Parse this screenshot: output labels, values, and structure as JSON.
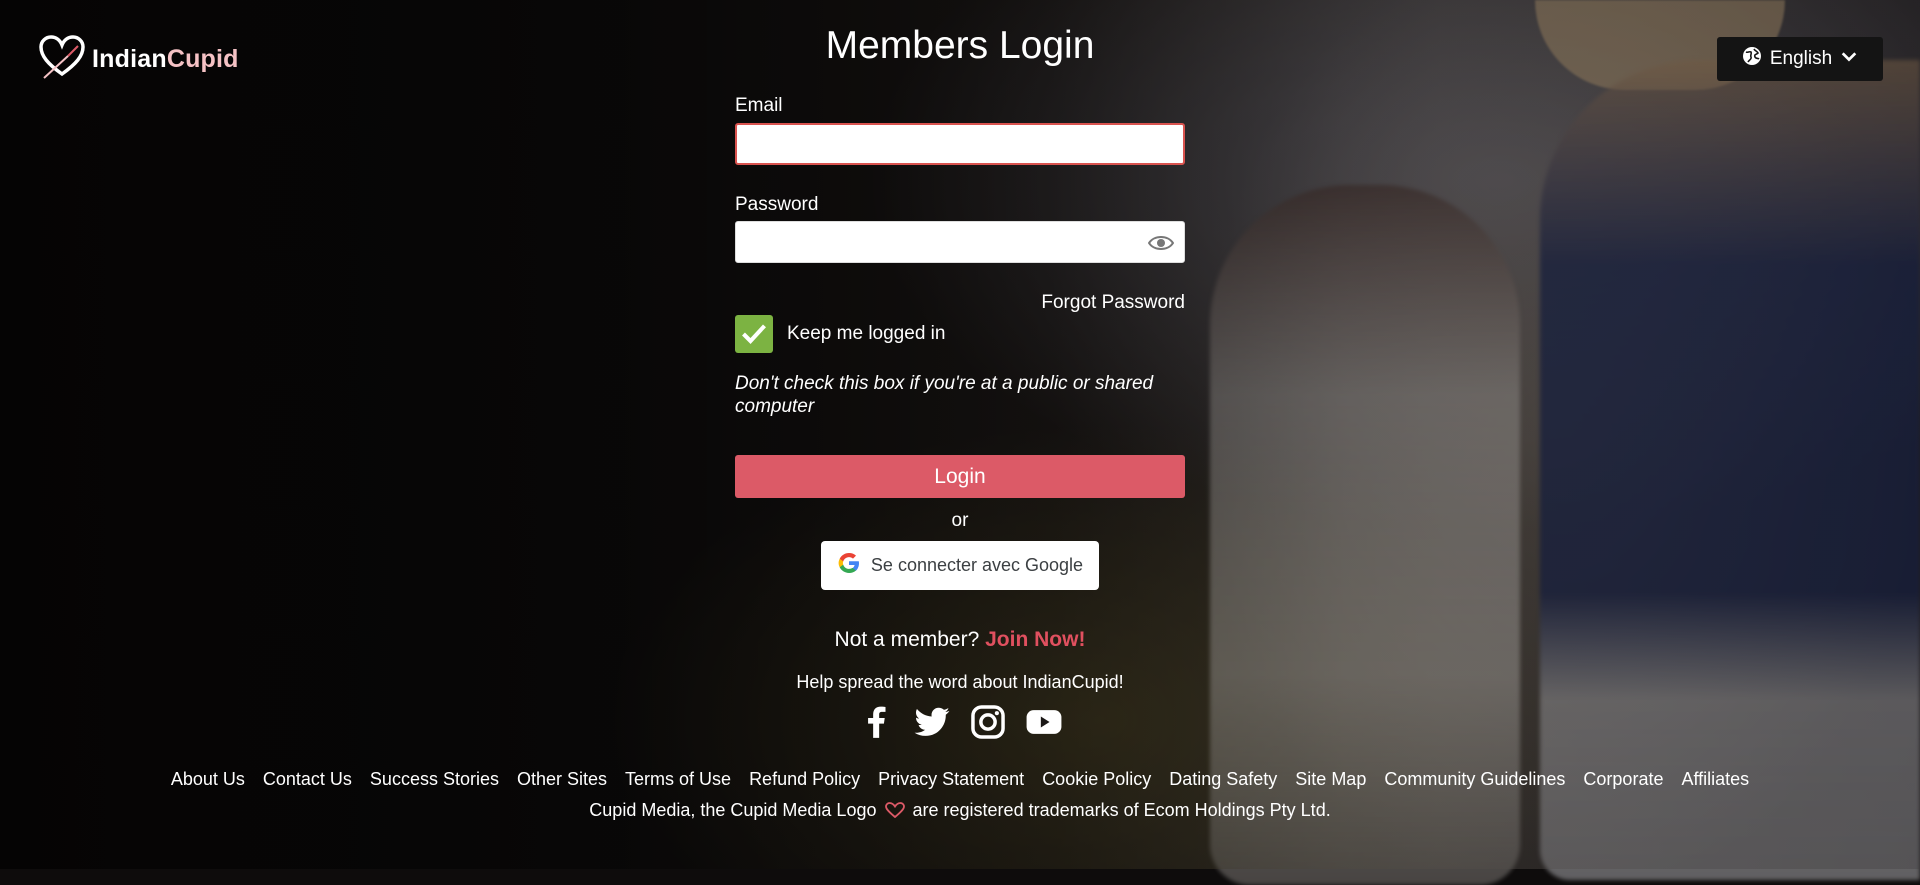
{
  "brand": {
    "name_part1": "Indian",
    "name_part2": "Cupid",
    "logo_icon": "heart-arrow-logo-icon",
    "accent_color": "#dc5a67"
  },
  "language": {
    "selected": "English",
    "icon": "globe-icon"
  },
  "login": {
    "title": "Members Login",
    "email_label": "Email",
    "email_value": "",
    "password_label": "Password",
    "password_value": "",
    "forgot_password": "Forgot Password",
    "keep_logged_in": "Keep me logged in",
    "keep_logged_in_checked": true,
    "warning": "Don't check this box if you're at a public or shared computer",
    "login_button": "Login",
    "or_text": "or",
    "google_button": "Se connecter avec Google",
    "not_member": "Not a member?",
    "join_now": "Join Now!",
    "checkbox_color": "#7cb342"
  },
  "social": {
    "heading": "Help spread the word about IndianCupid!",
    "icons": [
      "facebook-icon",
      "twitter-icon",
      "instagram-icon",
      "youtube-icon"
    ]
  },
  "footer": {
    "links": [
      "About Us",
      "Contact Us",
      "Success Stories",
      "Other Sites",
      "Terms of Use",
      "Refund Policy",
      "Privacy Statement",
      "Cookie Policy",
      "Dating Safety",
      "Site Map",
      "Community Guidelines",
      "Corporate",
      "Affiliates"
    ],
    "trademark_part1": "Cupid Media, the Cupid Media Logo",
    "trademark_part2": "are registered trademarks of Ecom Holdings Pty Ltd."
  }
}
